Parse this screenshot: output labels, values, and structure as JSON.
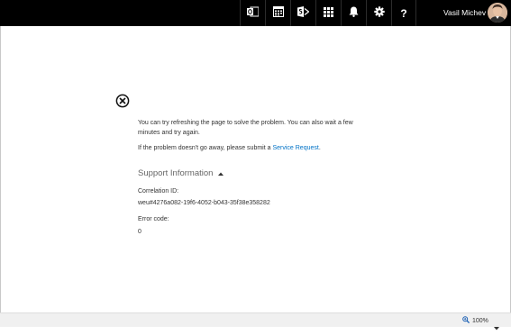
{
  "header": {
    "icons": [
      {
        "name": "outlook-icon"
      },
      {
        "name": "calendar-icon"
      },
      {
        "name": "sharepoint-icon"
      },
      {
        "name": "app-launcher-icon"
      },
      {
        "name": "bell-icon"
      },
      {
        "name": "gear-icon"
      },
      {
        "name": "help-icon",
        "glyph": "?"
      }
    ],
    "user_name": "Vasil Michev"
  },
  "error": {
    "message1": "You can try refreshing the page to solve the problem. You can also wait a few minutes and try again.",
    "message2_prefix": "If the problem doesn't go away, please submit a ",
    "message2_link": "Service Request",
    "message2_suffix": ".",
    "support_heading": "Support Information",
    "correlation_label": "Correlation ID:",
    "correlation_value": "weu#4276a082-19f6-4052-b043-35f38e358282",
    "error_code_label": "Error code:",
    "error_code_value": "0"
  },
  "statusbar": {
    "zoom": "100%"
  }
}
